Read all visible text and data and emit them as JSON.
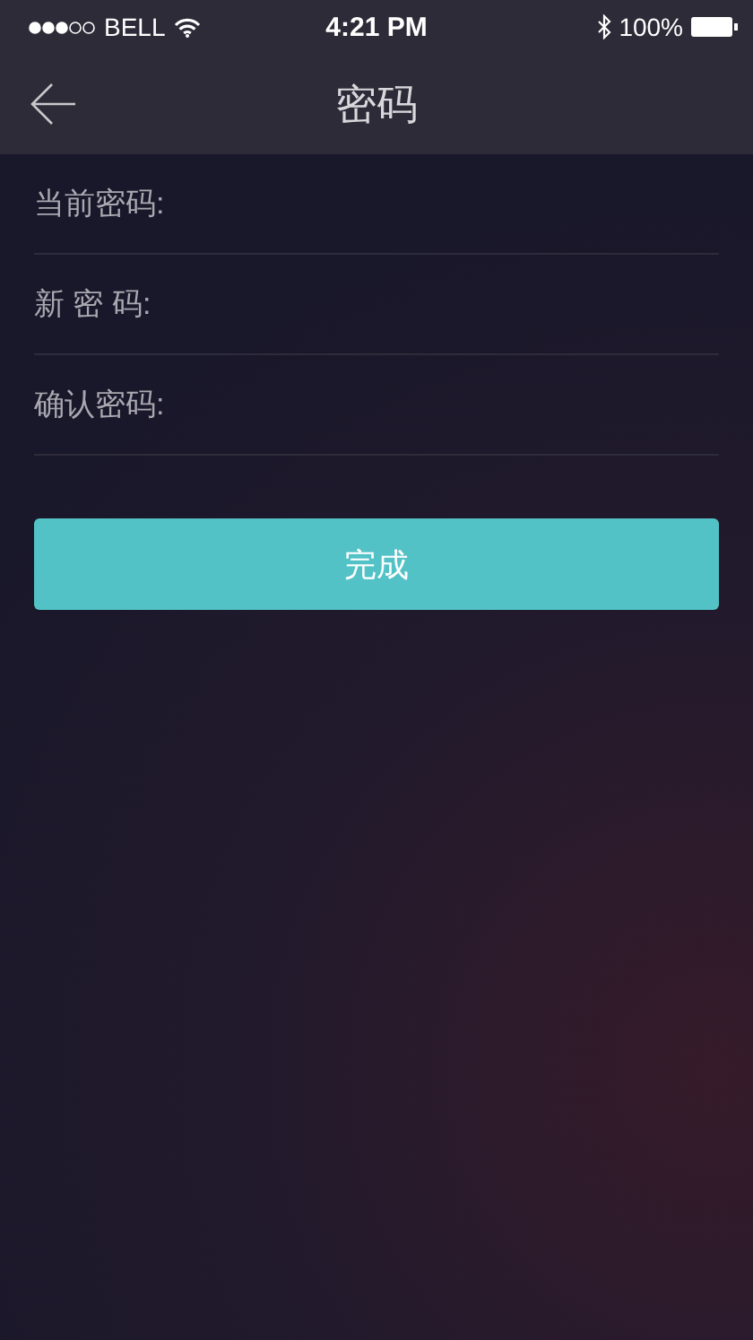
{
  "status_bar": {
    "carrier": "BELL",
    "time": "4:21 PM",
    "battery": "100%"
  },
  "nav": {
    "title": "密码"
  },
  "fields": [
    {
      "label": "当前密码:"
    },
    {
      "label": "新 密 码:"
    },
    {
      "label": "确认密码:"
    }
  ],
  "button": {
    "label": "完成"
  }
}
